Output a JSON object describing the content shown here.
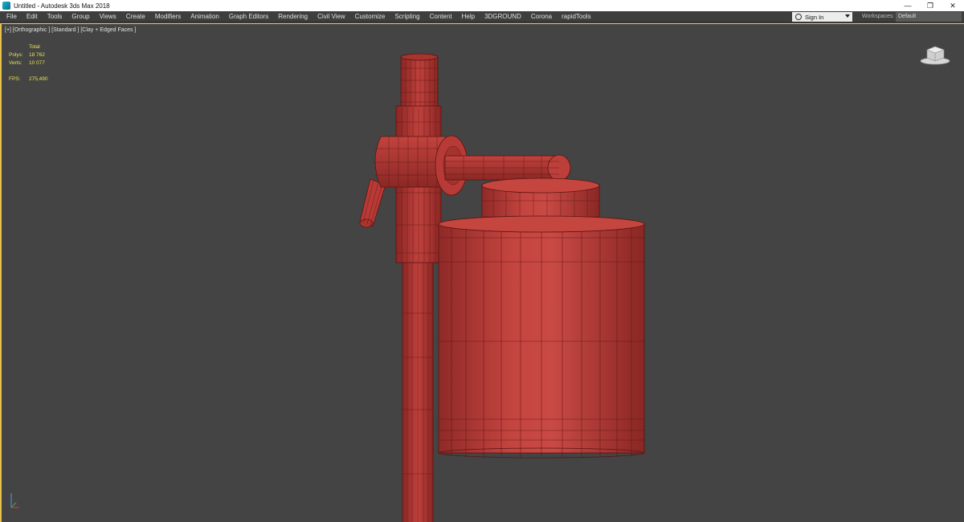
{
  "titlebar": {
    "title": "Untitled - Autodesk 3ds Max 2018",
    "minimize": "—",
    "restore": "❐",
    "close": "✕"
  },
  "menu": {
    "items": [
      "File",
      "Edit",
      "Tools",
      "Group",
      "Views",
      "Create",
      "Modifiers",
      "Animation",
      "Graph Editors",
      "Rendering",
      "Civil View",
      "Customize",
      "Scripting",
      "Content",
      "Help",
      "3DGROUND",
      "Corona",
      "rapidTools"
    ],
    "signin_label": "Sign In",
    "workspaces_label": "Workspaces:",
    "workspaces_value": "Default"
  },
  "viewport": {
    "label": "[+] [Orthographic ] [Standard ] [Clay + Edged Faces ]",
    "stats": {
      "total_label": "Total",
      "polys_label": "Polys:",
      "polys_value": "18 762",
      "verts_label": "Verts:",
      "verts_value": "10 077",
      "fps_label": "FPS:",
      "fps_value": "275,490"
    }
  },
  "colors": {
    "viewport_bg": "#444444",
    "model_red": "#b83a36",
    "wire": "#5a1512",
    "active_border": "#e6c24a",
    "stats_text": "#e8e055"
  }
}
